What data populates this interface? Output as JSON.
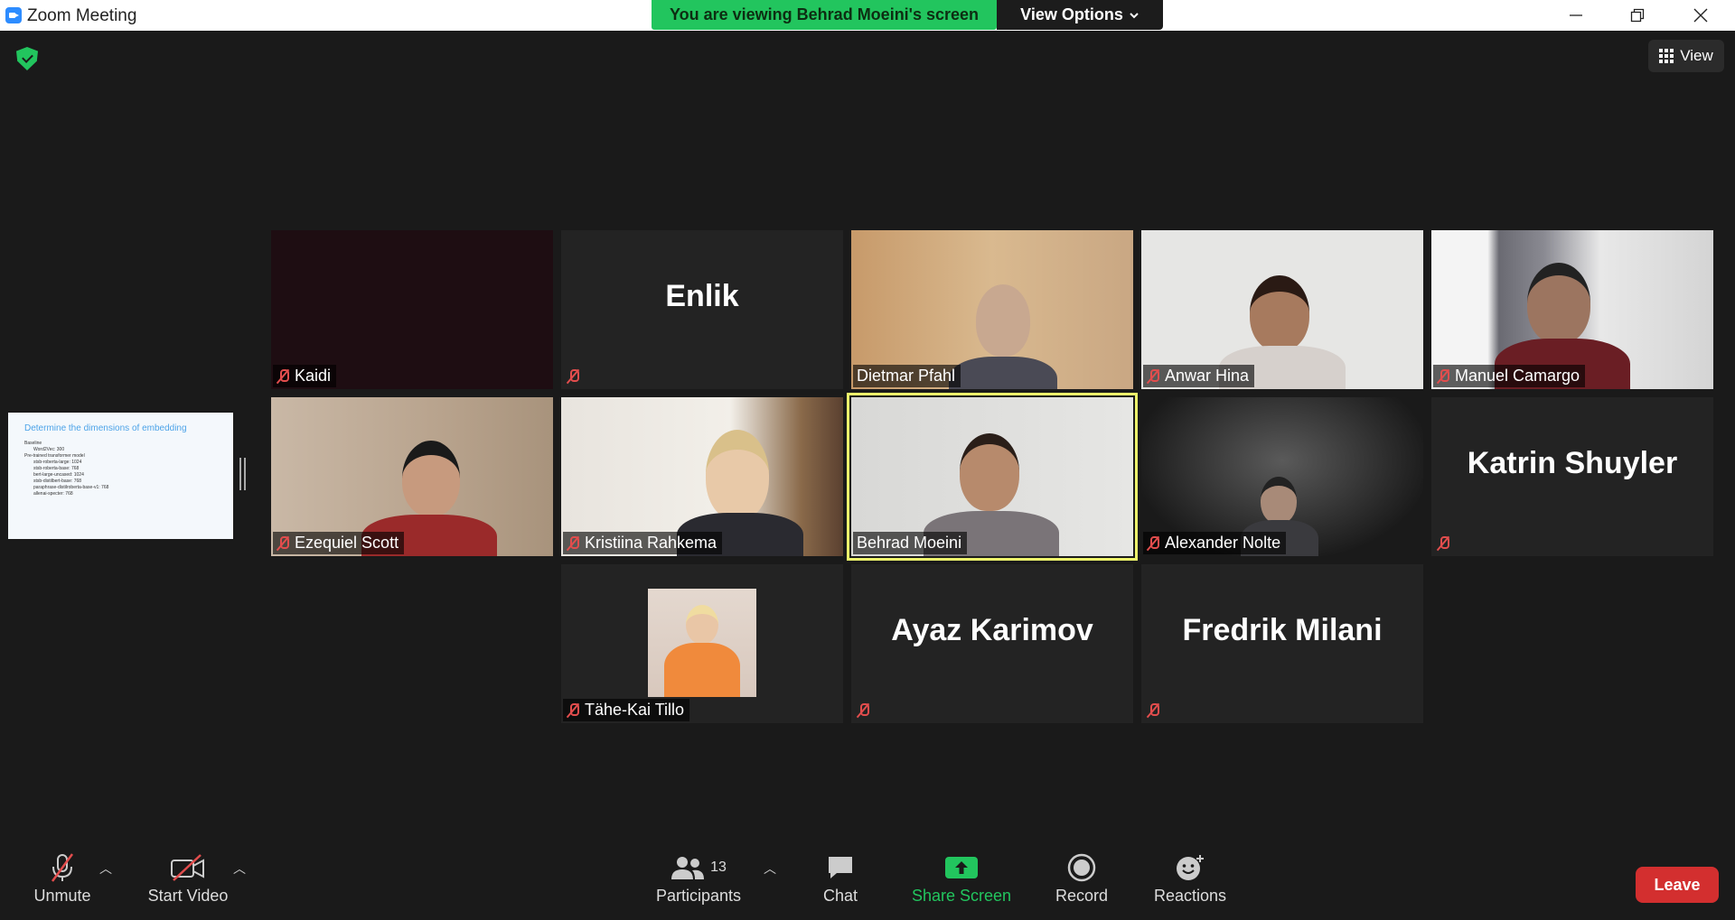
{
  "window": {
    "title": "Zoom Meeting"
  },
  "banner": {
    "text": "You are viewing Behrad Moeini's screen",
    "view_options": "View Options",
    "color": "#22c55e"
  },
  "top_right": {
    "view_label": "View"
  },
  "share_preview": {
    "heading": "Determine the dimensions of embedding",
    "items": [
      "Baseline",
      "Word2Vec: 300",
      "Pre-trained transformer model",
      "stsb-roberta-large: 1024",
      "stsb-roberta-base: 768",
      "bert-large-uncased: 1024",
      "stsb-distilbert-base: 768",
      "paraphrase-distilroberta-base-v1: 768",
      "allenai-specter: 768"
    ]
  },
  "participants": [
    {
      "name": "Kaidi",
      "muted": true,
      "video": "dark"
    },
    {
      "name": "Enlik",
      "muted": true,
      "video": "none",
      "big_name": "Enlik"
    },
    {
      "name": "Dietmar Pfahl",
      "muted": false,
      "video": "on"
    },
    {
      "name": "Anwar Hina",
      "muted": true,
      "video": "on"
    },
    {
      "name": "Manuel Camargo",
      "muted": true,
      "video": "on"
    },
    {
      "name": "Ezequiel Scott",
      "muted": true,
      "video": "on"
    },
    {
      "name": "Kristiina Rahkema",
      "muted": true,
      "video": "on"
    },
    {
      "name": "Behrad Moeini",
      "muted": false,
      "video": "on",
      "active_speaker": true
    },
    {
      "name": "Alexander Nolte",
      "muted": true,
      "video": "on"
    },
    {
      "name": "Katrin Shuyler",
      "muted": true,
      "video": "none",
      "big_name": "Katrin Shuyler"
    },
    {
      "name": "Tähe-Kai Tillo",
      "muted": true,
      "video": "photo"
    },
    {
      "name": "Ayaz Karimov",
      "muted": true,
      "video": "none",
      "big_name": "Ayaz Karimov"
    },
    {
      "name": "Fredrik Milani",
      "muted": true,
      "video": "none",
      "big_name": "Fredrik Milani"
    }
  ],
  "toolbar": {
    "unmute": "Unmute",
    "start_video": "Start Video",
    "participants": "Participants",
    "participant_count": "13",
    "chat": "Chat",
    "share_screen": "Share Screen",
    "record": "Record",
    "reactions": "Reactions",
    "leave": "Leave",
    "share_color": "#22c55e",
    "leave_color": "#d32f2f"
  }
}
